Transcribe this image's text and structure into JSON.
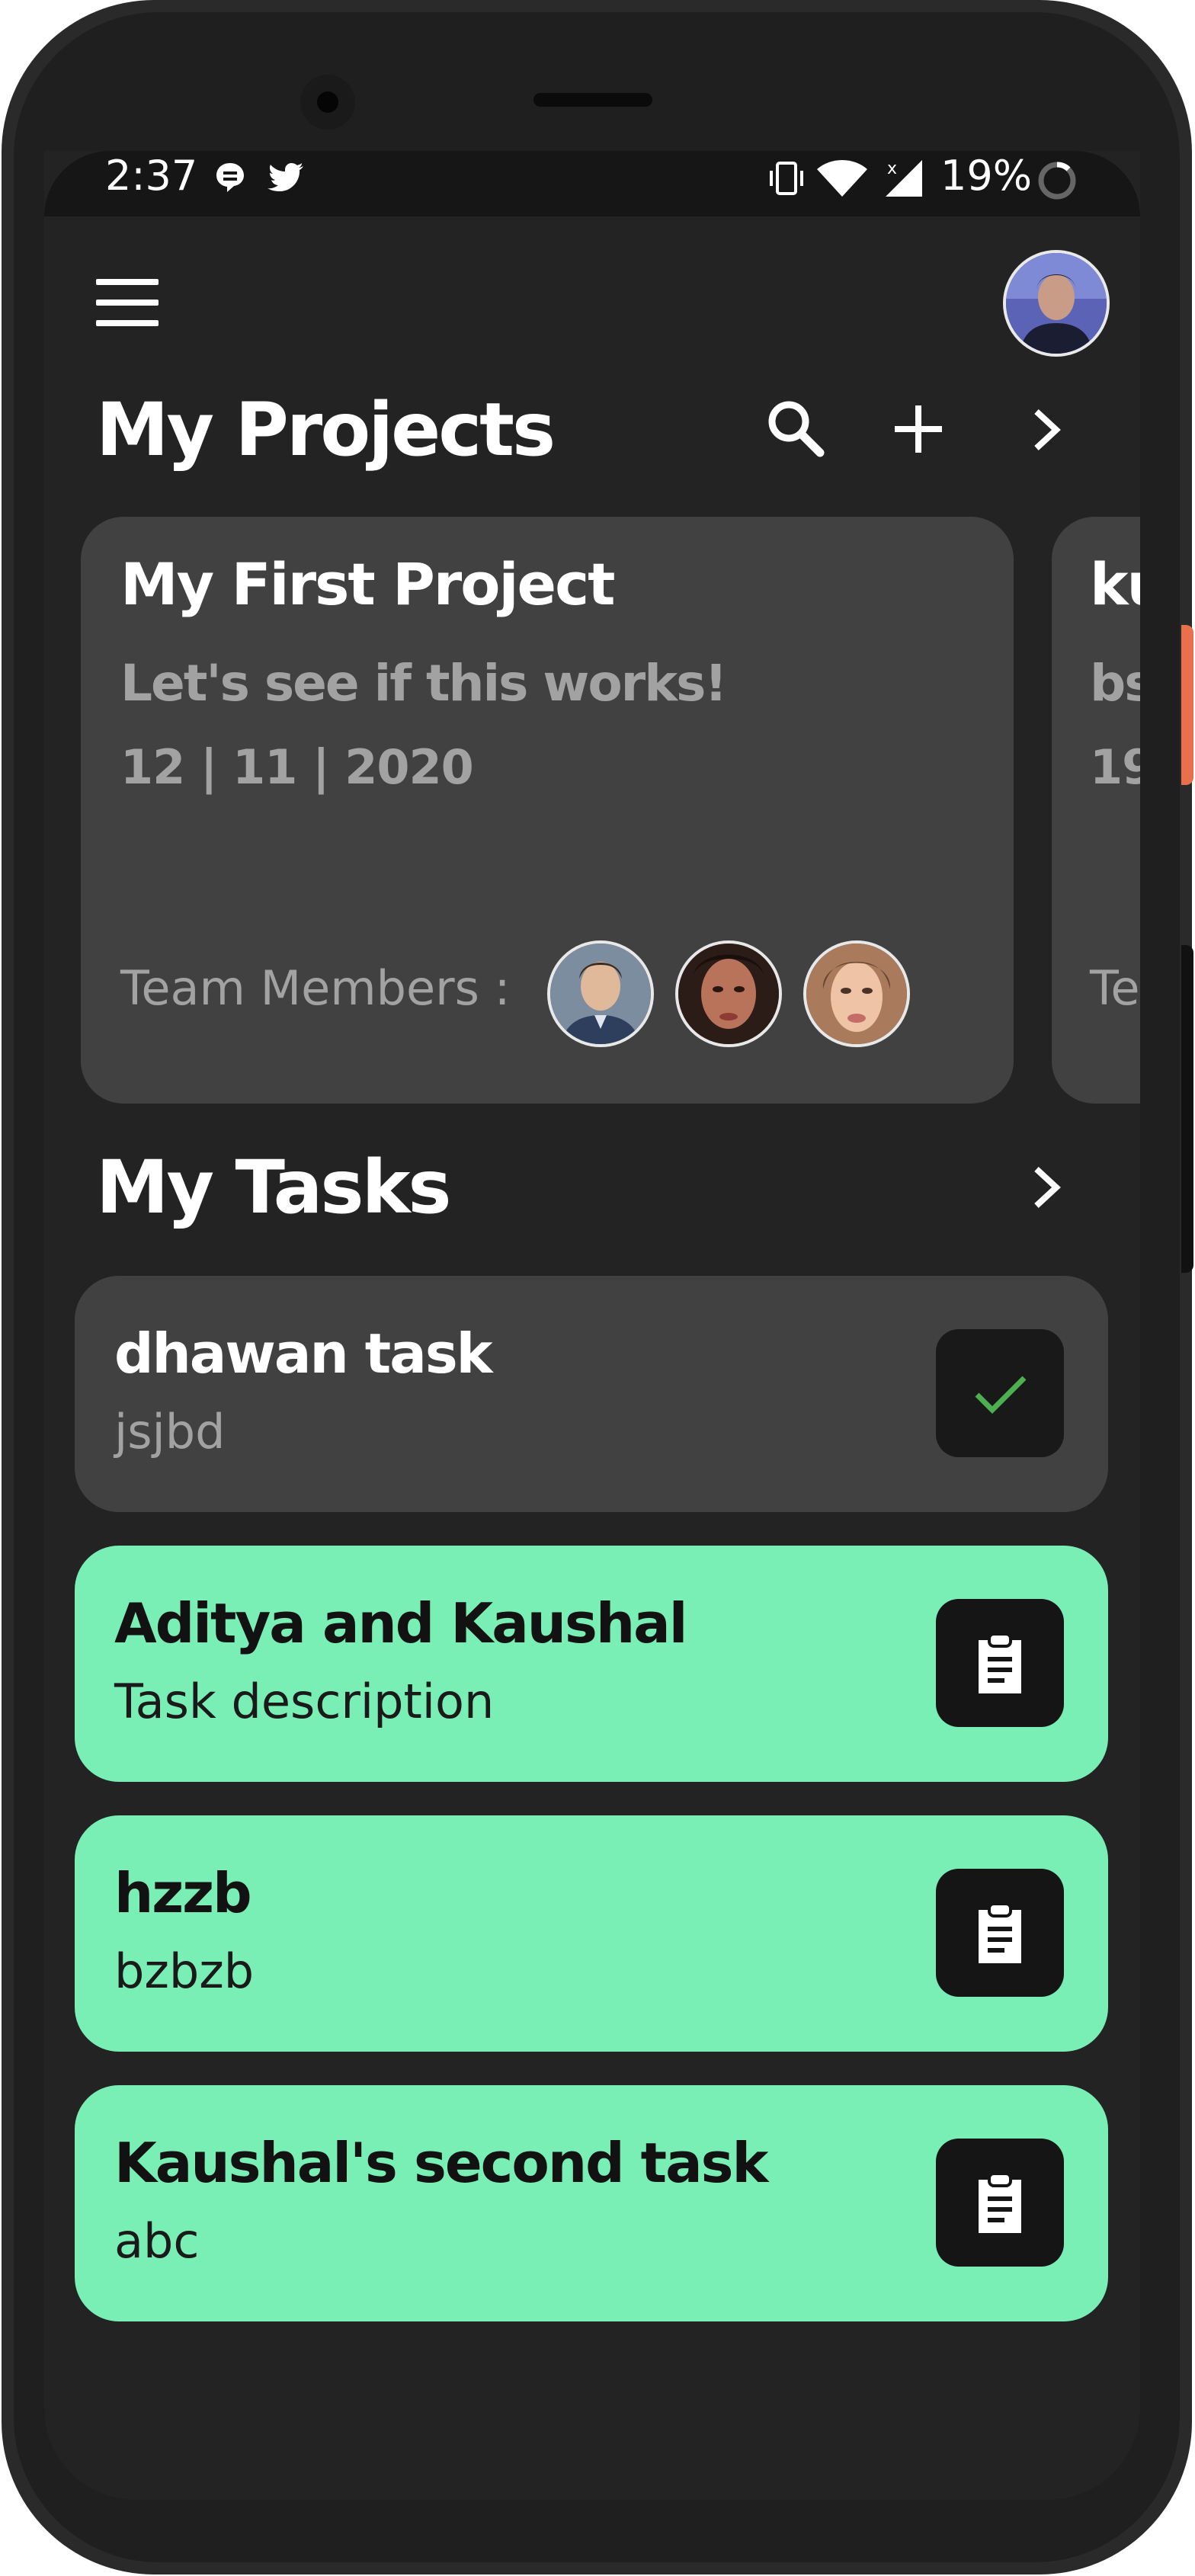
{
  "status_bar": {
    "time": "2:37",
    "battery": "19%",
    "icons": [
      "chat-bubble-icon",
      "twitter-icon",
      "vibrate-icon",
      "wifi-icon",
      "signal-icon",
      "battery-ring-icon"
    ]
  },
  "app_bar": {
    "menu_icon": "hamburger-menu-icon",
    "avatar": "user-avatar"
  },
  "projects": {
    "title": "My Projects",
    "actions": [
      "search-icon",
      "add-icon",
      "chevron-right-icon"
    ],
    "cards": [
      {
        "name": "My First Project",
        "description": "Let's see if this works!",
        "date": "12 | 11 | 2020",
        "team_label": "Team Members :",
        "members": [
          "member-avatar-1",
          "member-avatar-2",
          "member-avatar-3"
        ]
      },
      {
        "name": "ku",
        "description": "bs",
        "date": "19",
        "team_label": "Te"
      }
    ]
  },
  "tasks": {
    "title": "My Tasks",
    "items": [
      {
        "title": "dhawan task",
        "description": "jsjbd",
        "state": "completed",
        "icon": "check-icon"
      },
      {
        "title": "Aditya and Kaushal",
        "description": "Task description",
        "state": "pending",
        "icon": "clipboard-icon"
      },
      {
        "title": "hzzb",
        "description": "bzbzb",
        "state": "pending",
        "icon": "clipboard-icon"
      },
      {
        "title": "Kaushal's second task",
        "description": "abc",
        "state": "pending",
        "icon": "clipboard-icon"
      }
    ]
  },
  "colors": {
    "background": "#232323",
    "card": "#414141",
    "task_pending": "#79EFB5",
    "task_completed": "#414141",
    "check": "#4CAF50",
    "muted_text": "#A2A2A2"
  }
}
